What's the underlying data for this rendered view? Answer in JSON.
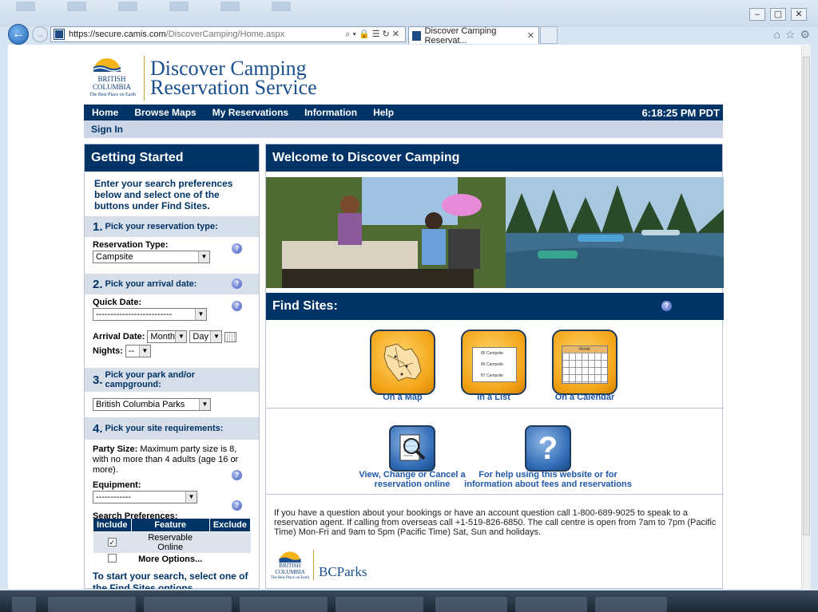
{
  "browser": {
    "url_prefix": "https://secure.camis.com",
    "url_path": "/DiscoverCamping/Home.aspx",
    "tab_title": "Discover Camping Reservat..."
  },
  "header": {
    "bc_line1": "BRITISH",
    "bc_line2": "COLUMBIA",
    "bc_slogan": "The Best Place on Earth",
    "title_line1": "Discover Camping",
    "title_line2": "Reservation Service"
  },
  "nav": {
    "items": [
      "Home",
      "Browse Maps",
      "My Reservations",
      "Information",
      "Help"
    ],
    "clock": "6:18:25 PM PDT",
    "sign_in": "Sign In"
  },
  "left": {
    "title": "Getting Started",
    "intro": "Enter your search preferences below and select one of the buttons under Find Sites.",
    "step1_num": "1.",
    "step1_label": "Pick your reservation type:",
    "reservation_type_label": "Reservation Type:",
    "reservation_type_value": "Campsite",
    "step2_num": "2.",
    "step2_label": "Pick your arrival date:",
    "quick_date_label": "Quick Date:",
    "quick_date_value": "--------------------------",
    "arrival_date_label": "Arrival Date:",
    "month_value": "Month",
    "day_value": "Day",
    "nights_label": "Nights:",
    "nights_value": "--",
    "step3_num": "3.",
    "step3_label": "Pick your park and/or campground:",
    "park_value": "British Columbia Parks",
    "step4_num": "4.",
    "step4_label": "Pick your site requirements:",
    "party_size_label": "Party Size:",
    "party_size_text": "Maximum party size is 8, with no more than 4 adults (age 16 or more).",
    "equipment_label": "Equipment:",
    "equipment_value": "------------",
    "search_prefs_label": "Search Preferences:",
    "pref_headers": [
      "Include",
      "Feature",
      "Exclude"
    ],
    "pref_row1_feature": "Reservable Online",
    "pref_row2_feature": "More Options...",
    "footer": "To start your search, select one of the Find Sites options."
  },
  "main": {
    "welcome_title": "Welcome to Discover Camping",
    "find_title": "Find Sites:",
    "opt_map": "On a Map",
    "opt_list": "In a List",
    "opt_calendar": "On a Calendar",
    "list_rows": [
      "85 Campsite",
      "86 Campsite",
      "87 Campsite"
    ],
    "cal_title": "Month",
    "view_line1": "View, Change or Cancel a",
    "view_line2": "reservation online",
    "help_line1": "For help using this website or for",
    "help_line2": "information about fees and reservations",
    "info_text": "If you have a question about your bookings or have an account question call 1-800-689-9025 to speak to a reservation agent. If calling from overseas call +1-519-826-6850. The call centre is open from 7am to 7pm (Pacific Time) Mon-Fri and 9am to 5pm (Pacific Time) Sat, Sun and holidays.",
    "bcparks_label": "BCParks",
    "bcparks_bc1": "BRITISH",
    "bcparks_bc2": "COLUMBIA",
    "bcparks_slogan": "The Best Place on Earth"
  },
  "colors": {
    "navy": "#003366",
    "link": "#1f58a8",
    "gold": "#f3a417"
  }
}
